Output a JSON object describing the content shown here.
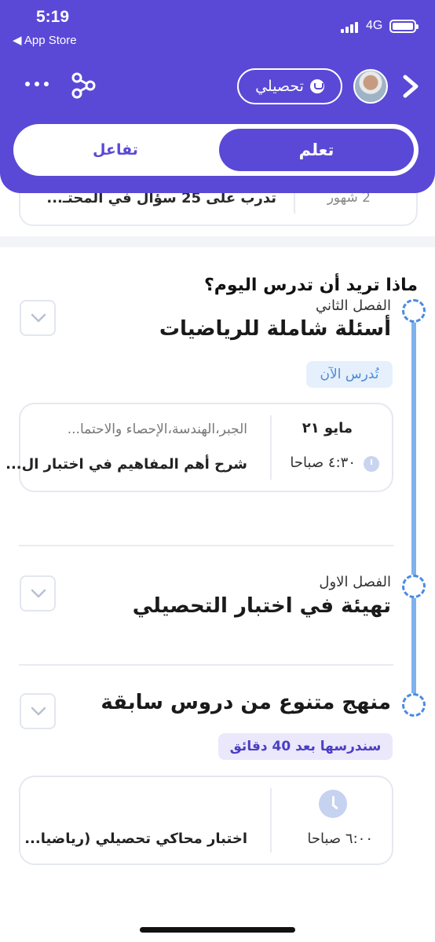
{
  "status": {
    "time": "5:19",
    "back_label": "◀ App Store",
    "network": "4G"
  },
  "header": {
    "subject_chip": "تحصيلي",
    "tabs": {
      "learn": "تعلم",
      "interact": "تفاعل"
    }
  },
  "peek_card": {
    "text": "تدرب على 25 سؤال في المحتـ...",
    "months": "2 شهور"
  },
  "main": {
    "question": "ماذا تريد أن تدرس اليوم؟",
    "sections": [
      {
        "subtitle": "الفصل الثاني",
        "title": "أسئلة شاملة للرياضيات",
        "badge": "تُدرس الآن",
        "card": {
          "date": "مايو ٢١",
          "time": "٤:٣٠ صباحا",
          "topics": "الجبر،الهندسة،الإحصاء والاحتما...",
          "description": "شرح أهم المفاهيم في اختبار ال..."
        }
      },
      {
        "subtitle": "الفصل الاول",
        "title": "تهيئة في اختبار التحصيلي"
      },
      {
        "title": "منهج متنوع من دروس سابقة",
        "badge": "سندرسها بعد 40 دقائق",
        "card": {
          "time": "٦:٠٠ صباحا",
          "description": "اختبار محاكي تحصيلي (رياضيا..."
        }
      }
    ]
  },
  "colors": {
    "brand": "#5a49d6",
    "timeline": "#7fb2ec",
    "badge_now_bg": "#e6f0fc",
    "badge_later_bg": "#ebe8fb"
  },
  "icons": [
    "more-icon",
    "share-icon",
    "chat-icon",
    "chevron-right-icon",
    "chevron-down-icon",
    "clock-icon"
  ]
}
